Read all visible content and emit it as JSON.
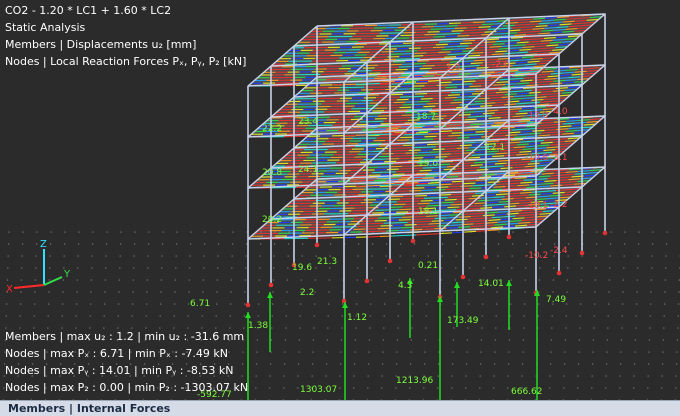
{
  "viewport": {
    "header_lines": [
      "CO2 - 1.20 * LC1 + 1.60 * LC2",
      "Static Analysis",
      "Members | Displacements u₂ [mm]",
      "Nodes | Local Reaction Forces Pₓ, Pᵧ, P₂ [kN]"
    ],
    "summary_lines": [
      "Members | max u₂ : 1.2 | min u₂ : -31.6 mm",
      "Nodes | max Pₓ : 6.71 | min Pₓ : -7.49 kN",
      "Nodes | max Pᵧ : 14.01 | min Pᵧ : -8.53 kN",
      "Nodes | max P₂ : 0.00 | min P₂ : -1303.07 kN"
    ],
    "axis_labels": {
      "x": "X",
      "y": "Y",
      "z": "Z"
    },
    "red_labels": [
      "1.0",
      "-2.6",
      "-4.0",
      "-13.0",
      "-3.1",
      "-10.6",
      "-10.1",
      "-2.4",
      "-10.2",
      "-2.2"
    ],
    "green_labels": [
      "22.2",
      "23.4",
      "18.7",
      "20.8",
      "24.1",
      "19.0",
      "20.2",
      "18.1",
      "19.6",
      "21.3",
      "2.2",
      "4.3",
      "0.21",
      "12.1"
    ],
    "reaction_labels": [
      "6.71",
      "1.38",
      "1.12",
      "173.49",
      "7.49",
      "14.01",
      "1303.07",
      "1213.96",
      "666.62",
      "-592.77"
    ]
  },
  "bottom_panel": {
    "title": "Members | Internal Forces"
  },
  "colors": {
    "background": "#2b2b2b",
    "frame": "#c7d3ea",
    "support": "#e23232",
    "reaction": "#22dd22",
    "panel": "#d5dce7"
  }
}
